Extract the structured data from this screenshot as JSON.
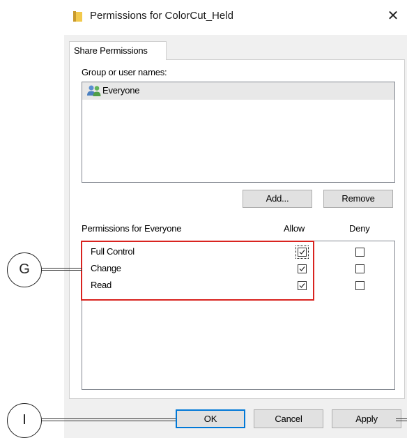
{
  "window": {
    "title": "Permissions for ColorCut_Held",
    "close_glyph": "✕",
    "icon": "folder-icon"
  },
  "tab": {
    "label": "Share Permissions"
  },
  "group_section": {
    "label": "Group or user names:",
    "items": [
      {
        "name": "Everyone",
        "icon": "users-icon",
        "selected": true
      }
    ]
  },
  "buttons": {
    "add": "Add...",
    "remove": "Remove",
    "ok": "OK",
    "cancel": "Cancel",
    "apply": "Apply"
  },
  "permissions": {
    "label": "Permissions for Everyone",
    "allow_header": "Allow",
    "deny_header": "Deny",
    "rows": [
      {
        "name": "Full Control",
        "allow": true,
        "deny": false
      },
      {
        "name": "Change",
        "allow": true,
        "deny": false
      },
      {
        "name": "Read",
        "allow": true,
        "deny": false
      }
    ]
  },
  "callouts": {
    "g": "G",
    "i": "I"
  },
  "colors": {
    "highlight": "#d9231f",
    "primary_border": "#0078d7",
    "selected_row": "#e8e8e8"
  }
}
